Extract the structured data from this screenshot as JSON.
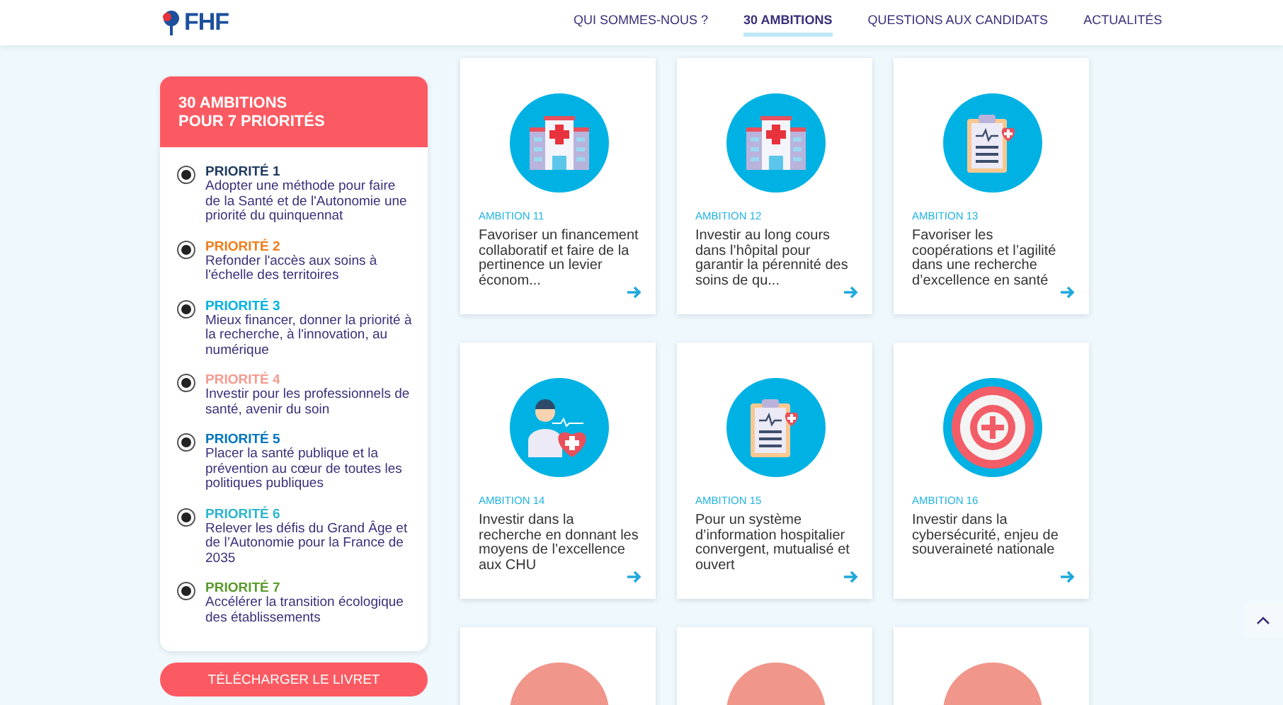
{
  "header": {
    "logo": "FHF",
    "nav": [
      {
        "label": "QUI SOMMES-NOUS ?",
        "selected": false
      },
      {
        "label": "30 AMBITIONS",
        "selected": true
      },
      {
        "label": "QUESTIONS AUX CANDIDATS",
        "selected": false
      },
      {
        "label": "ACTUALITÉS",
        "selected": false
      }
    ]
  },
  "sidebar": {
    "title_lines": [
      "30 AMBITIONS",
      "POUR 7 PRIORITÉS"
    ],
    "priorities": [
      {
        "label": "PRIORITÉ 1",
        "color": "#1f3a5f",
        "text": "Adopter une méthode pour faire de la Santé et de l'Autonomie une priorité du quinquennat",
        "checked": true
      },
      {
        "label": "PRIORITÉ 2",
        "color": "#f07d19",
        "text": "Refonder l'accès aux soins à l'échelle des territoires",
        "checked": true
      },
      {
        "label": "PRIORITÉ 3",
        "color": "#00b2e3",
        "text": "Mieux financer, donner la priorité à la recherche, à l'innovation, au numérique",
        "checked": true
      },
      {
        "label": "PRIORITÉ 4",
        "color": "#f59a8f",
        "text": "Investir pour les professionnels de santé, avenir du soin",
        "checked": true
      },
      {
        "label": "PRIORITÉ 5",
        "color": "#0076c0",
        "text": "Placer la santé publique et la prévention au cœur de toutes les politiques publiques",
        "checked": true
      },
      {
        "label": "PRIORITÉ 6",
        "color": "#2bb5d0",
        "text": "Relever les défis du Grand Âge et de l’Autonomie pour la France de 2035",
        "checked": true
      },
      {
        "label": "PRIORITÉ 7",
        "color": "#5a9a2c",
        "text": "Accélérer la transition écologique des établissements",
        "checked": true
      }
    ],
    "download_button": "TÉLÉCHARGER LE LIVRET"
  },
  "cards": [
    {
      "kind": "hospital",
      "color": "#00b2e3",
      "label": "AMBITION 11",
      "text": "Favoriser un financement collaboratif et faire de la pertinence un levier économ..."
    },
    {
      "kind": "hospital",
      "color": "#00b2e3",
      "label": "AMBITION 12",
      "text": "Investir au long cours dans l’hôpital pour garantir la pérennité des soins de qu..."
    },
    {
      "kind": "clipboard",
      "color": "#00b2e3",
      "label": "AMBITION 13",
      "text": "Favoriser les coopérations et l’agilité dans une recherche d’excellence en santé"
    },
    {
      "kind": "doctor",
      "color": "#00b2e3",
      "label": "AMBITION 14",
      "text": "Investir dans la recherche en donnant les moyens de l’excellence aux CHU"
    },
    {
      "kind": "clipboard",
      "color": "#00b2e3",
      "label": "AMBITION 15",
      "text": "Pour un système d’information hospitalier convergent, mutualisé et ouvert"
    },
    {
      "kind": "target",
      "color": "#00b2e3",
      "label": "AMBITION 16",
      "text": "Investir dans la cybersécurité, enjeu de souveraineté nationale"
    },
    {
      "kind": "none",
      "color": "#f0968a"
    },
    {
      "kind": "none",
      "color": "#f0968a"
    },
    {
      "kind": "none",
      "color": "#f0968a"
    }
  ]
}
